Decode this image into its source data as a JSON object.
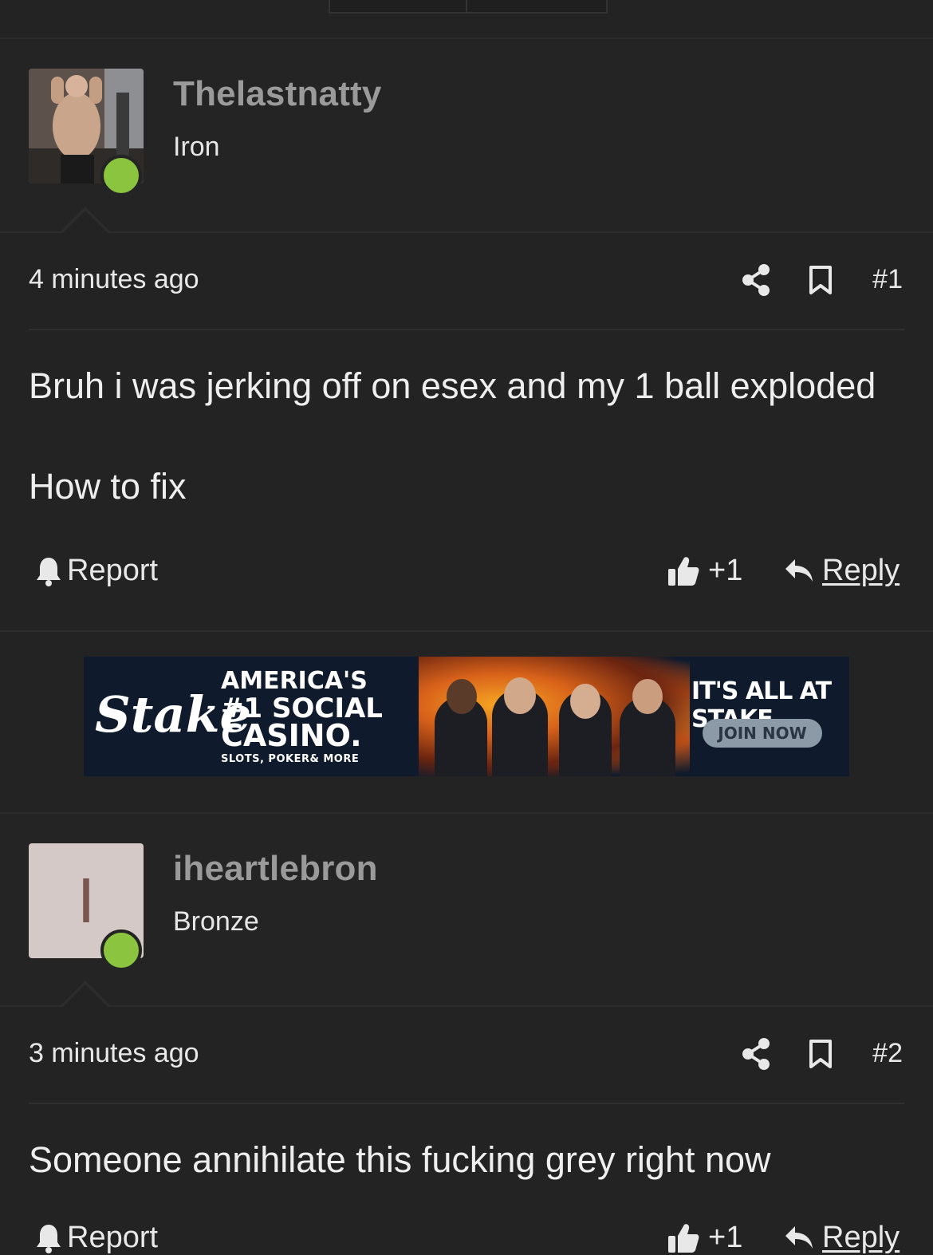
{
  "posts": [
    {
      "username": "Thelastnatty",
      "rank": "Iron",
      "time": "4 minutes ago",
      "number": "#1",
      "body": [
        "Bruh i was jerking off on esex and my 1 ball exploded",
        "How to fix"
      ],
      "report_label": "Report",
      "likes": "+1",
      "reply_label": "Reply"
    },
    {
      "username": "iheartlebron",
      "rank": "Bronze",
      "avatar_letter": "I",
      "time": "3 minutes ago",
      "number": "#2",
      "body": [
        "Someone annihilate this fucking grey right now"
      ],
      "report_label": "Report",
      "likes": "+1",
      "reply_label": "Reply"
    }
  ],
  "ad": {
    "brand": "Stake",
    "headline": [
      "AMERICA'S",
      "#1 SOCIAL",
      "CASINO."
    ],
    "subline": "SLOTS, POKER& MORE",
    "slogan": "IT'S ALL AT STAKE",
    "cta": "JOIN NOW"
  },
  "colors": {
    "background": "#232323",
    "online": "#8bc53f",
    "username": "#9a9a9a",
    "avatar_letter_bg": "#d4c9c7",
    "avatar_letter_fg": "#7a5650"
  },
  "icons": [
    "share-icon",
    "bookmark-icon",
    "bell-icon",
    "thumbs-up-icon",
    "reply-arrow-icon"
  ]
}
